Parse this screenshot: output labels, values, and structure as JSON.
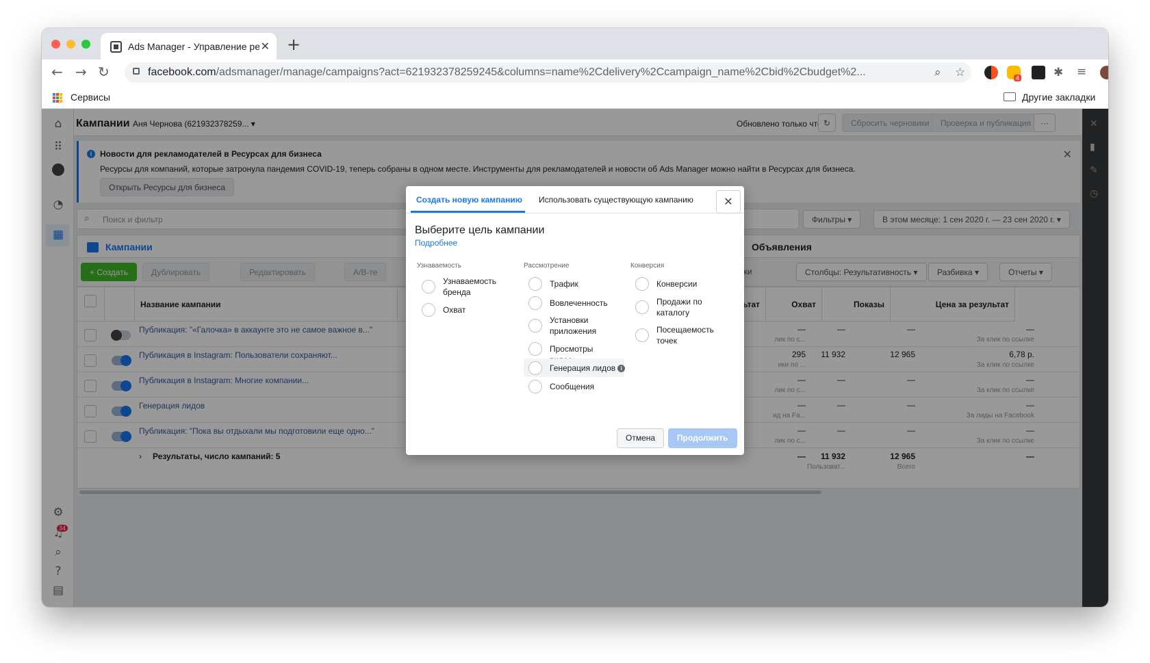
{
  "browser": {
    "tab_title": "Ads Manager - Управление ре",
    "url_domain": "facebook.com",
    "url_path": "/adsmanager/manage/campaigns?act=621932378259245&columns=name%2Cdelivery%2Ccampaign_name%2Cbid%2Cbudget%2...",
    "ext_badge": "4",
    "bookmark_services": "Сервисы",
    "bookmark_other": "Другие закладки"
  },
  "header": {
    "title": "Кампании",
    "account": "Аня Чернова (621932378259...",
    "updated": "Обновлено только что",
    "reset_drafts": "Сбросить черновики",
    "review_publish": "Проверка и публикация"
  },
  "news": {
    "title": "Новости для рекламодателей в Ресурсах для бизнеса",
    "body": "Ресурсы для компаний, которые затронула пандемия COVID-19, теперь собраны в одном месте. Инструменты для рекламодателей и новости об Ads Manager можно найти в Ресурсах для бизнеса.",
    "button": "Открыть Ресурсы для бизнеса"
  },
  "search": {
    "placeholder": "Поиск и фильтр"
  },
  "filters": {
    "label": "Фильтры",
    "date": "В этом месяце: 1 сен 2020 г. — 23 сен 2020 г."
  },
  "level_tabs": {
    "campaigns": "Кампании",
    "ads": "Объявления"
  },
  "actions": {
    "create": "Создать",
    "duplicate": "Дублировать",
    "edit": "Редактировать",
    "ab": "A/B-те",
    "settings": "стройки",
    "columns": "Столбцы: Результативность",
    "breakdown": "Разбивка",
    "reports": "Отчеты"
  },
  "table": {
    "headers": {
      "name": "Название кампании",
      "result": "езультат",
      "reach": "Охват",
      "impressions": "Показы",
      "cost": "Цена за результат"
    },
    "rows": [
      {
        "name": "Публикация: \"«Галочка» в аккаунте это не самое важное в...\"",
        "on": false,
        "result": "—",
        "result_sub": "лик по с...",
        "reach": "—",
        "impr": "—",
        "cost": "—",
        "cost_sub": "За клик по ссылке"
      },
      {
        "name": "Публикация в Instagram: Пользователи сохраняют...",
        "on": true,
        "result": "295",
        "result_sub": "ики по ...",
        "reach": "11 932",
        "impr": "12 965",
        "cost": "6,78 р.",
        "cost_sub": "За клик по ссылке"
      },
      {
        "name": "Публикация в Instagram: Многие компании...",
        "on": true,
        "result": "—",
        "result_sub": "лик по с...",
        "reach": "—",
        "impr": "—",
        "cost": "—",
        "cost_sub": "За клик по ссылке"
      },
      {
        "name": "Генерация лидов",
        "on": true,
        "result": "—",
        "result_sub": "ид на Fa...",
        "reach": "—",
        "impr": "—",
        "cost": "—",
        "cost_sub": "За лиды на Facebook"
      },
      {
        "name": "Публикация: \"Пока вы отдыхали мы подготовили еще одно...\"",
        "on": true,
        "result": "—",
        "result_sub": "лик по с...",
        "reach": "—",
        "impr": "—",
        "cost": "—",
        "cost_sub": "За клик по ссылке"
      }
    ],
    "summary": {
      "label": "Результаты, число кампаний: 5",
      "result": "—",
      "reach": "11 932",
      "reach_sub": "Пользоват...",
      "impr": "12 965",
      "impr_sub": "Всего",
      "cost": "—"
    }
  },
  "leftnav": {
    "notif_count": "34"
  },
  "modal": {
    "tab_new": "Создать новую кампанию",
    "tab_existing": "Использовать существующую кампанию",
    "heading": "Выберите цель кампании",
    "learn_more": "Подробнее",
    "columns": [
      {
        "label": "Узнаваемость",
        "options": [
          "Узнаваемость бренда",
          "Охват"
        ]
      },
      {
        "label": "Рассмотрение",
        "options": [
          "Трафик",
          "Вовлеченность",
          "Установки приложения",
          "Просмотры видео",
          "Генерация лидов",
          "Сообщения"
        ]
      },
      {
        "label": "Конверсия",
        "options": [
          "Конверсии",
          "Продажи по каталогу",
          "Посещаемость точек"
        ]
      }
    ],
    "cancel": "Отмена",
    "continue": "Продолжить"
  }
}
